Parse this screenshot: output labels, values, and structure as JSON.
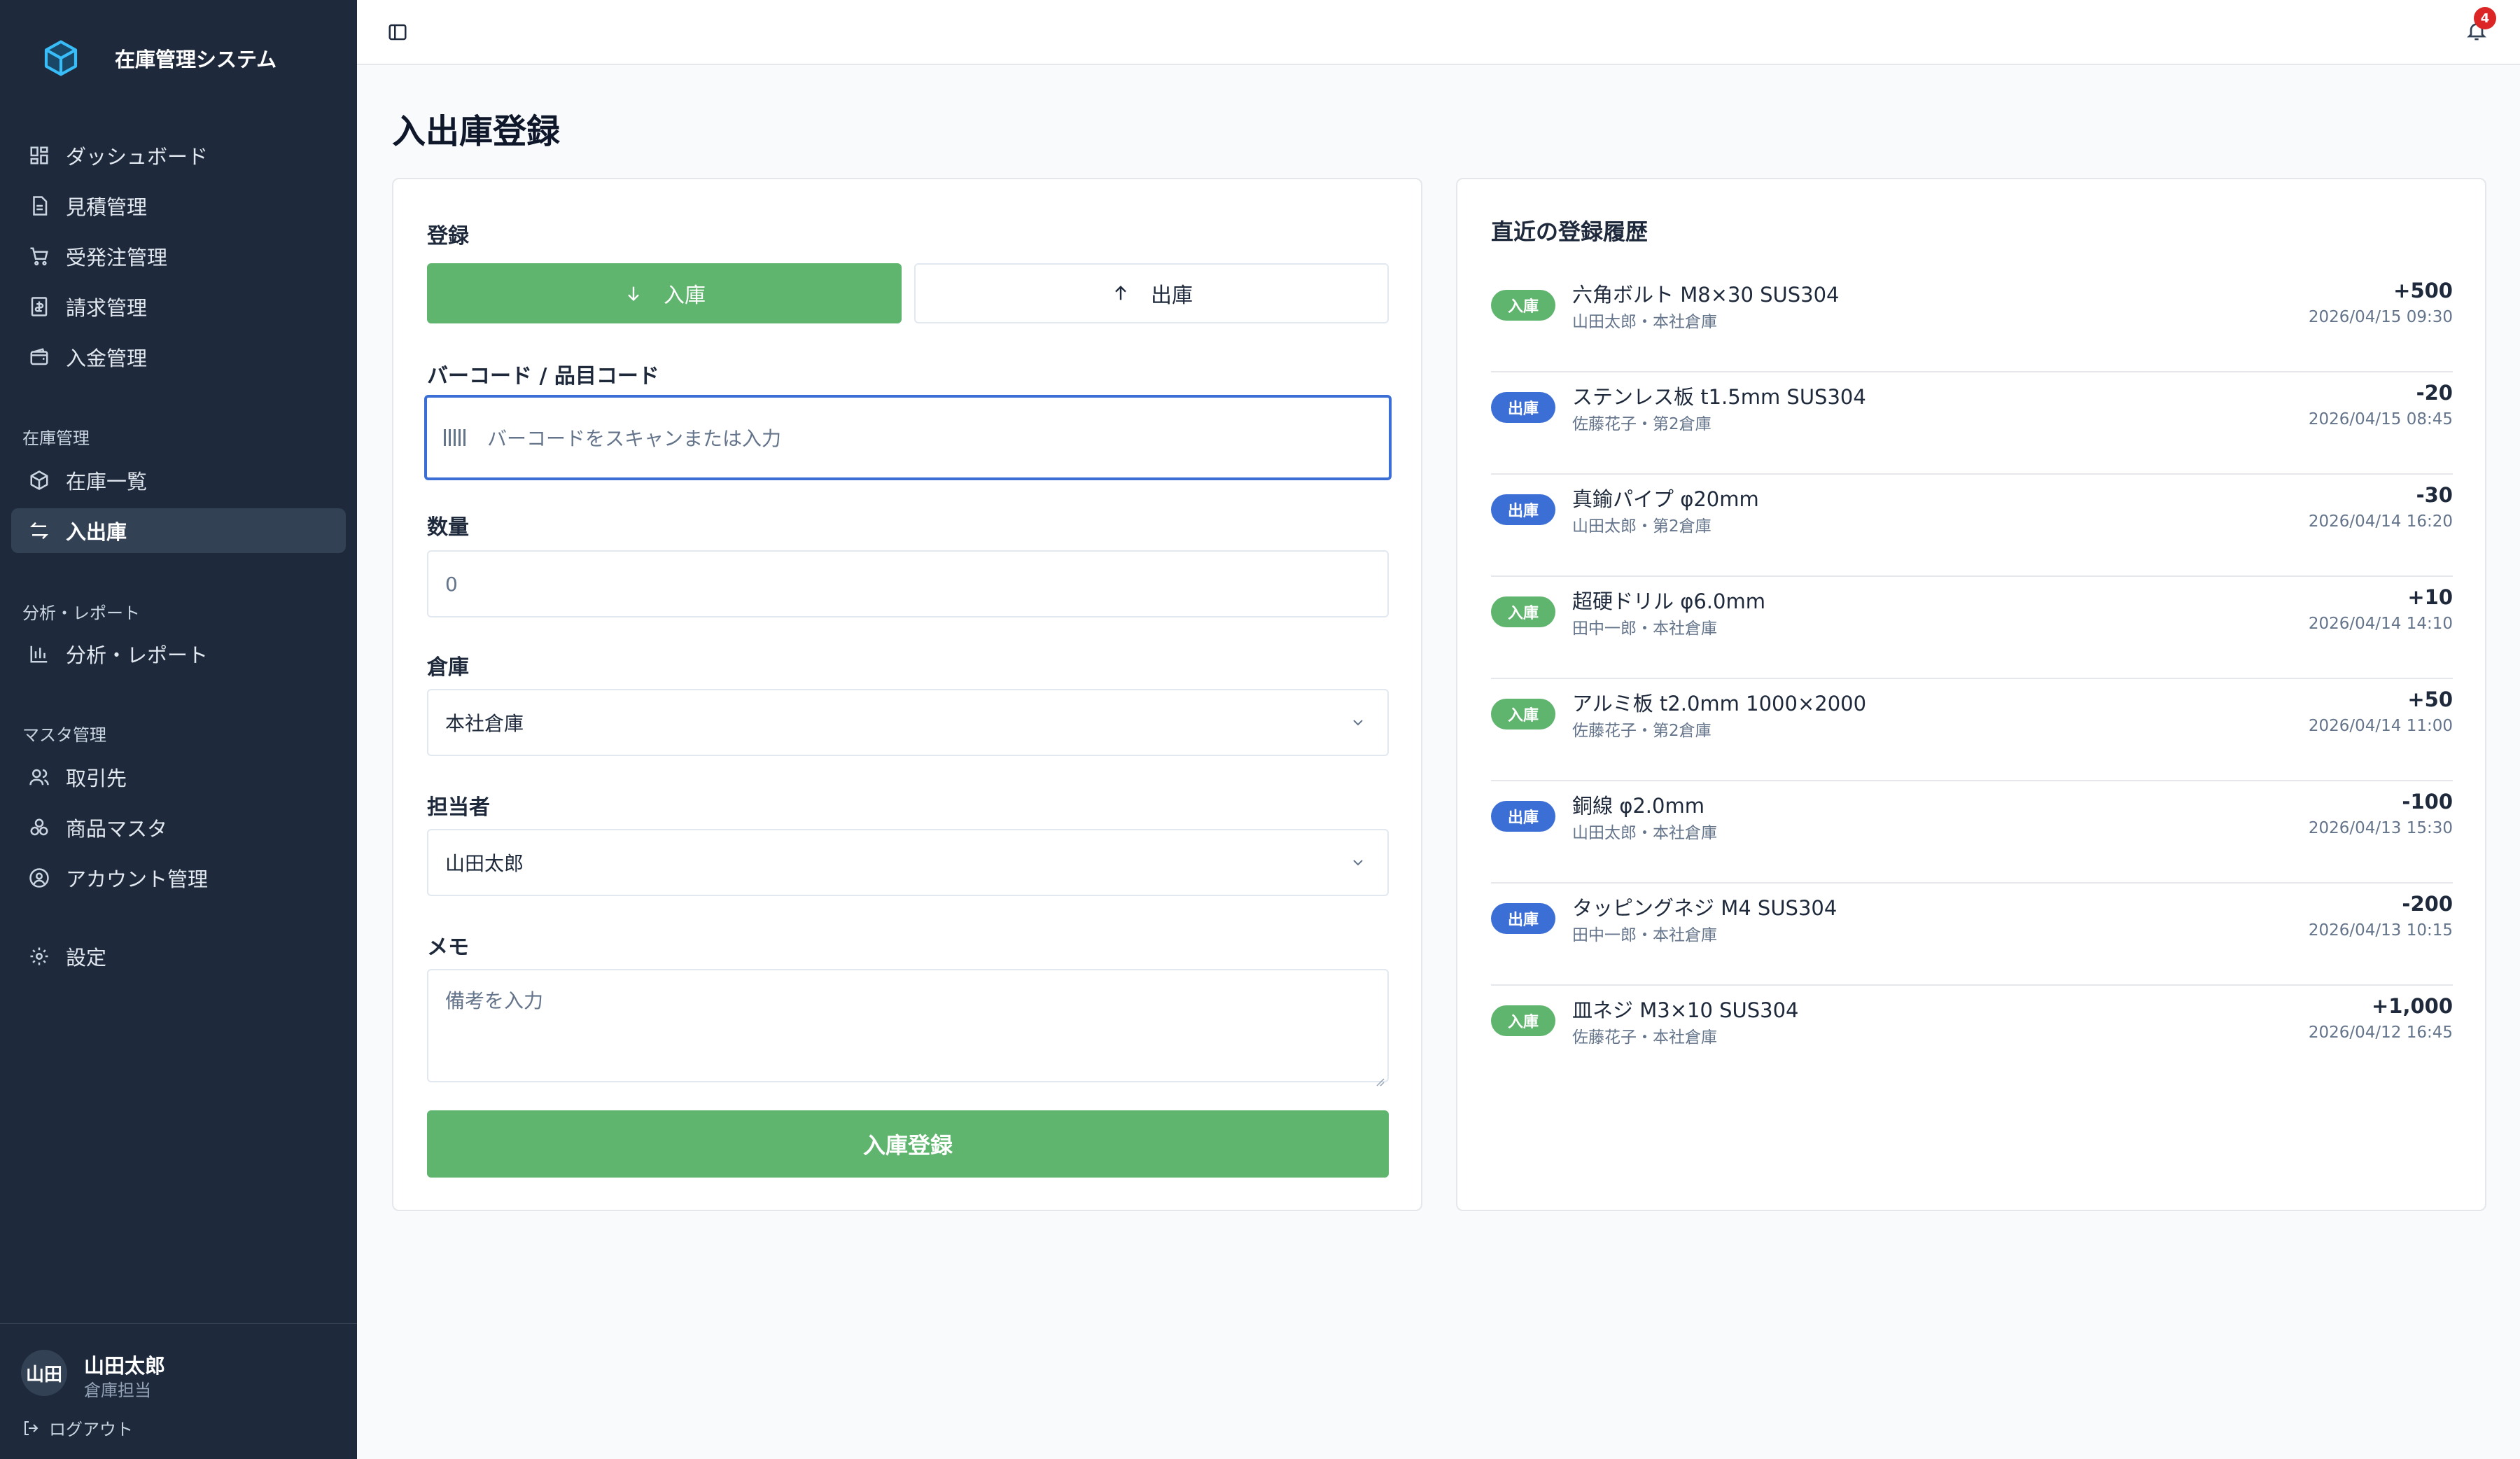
{
  "app": {
    "title": "在庫管理システム"
  },
  "sidebar": {
    "items": [
      {
        "label": "ダッシュボード",
        "icon": "dashboard-icon"
      },
      {
        "label": "見積管理",
        "icon": "document-icon"
      },
      {
        "label": "受発注管理",
        "icon": "cart-icon"
      },
      {
        "label": "請求管理",
        "icon": "invoice-icon"
      },
      {
        "label": "入金管理",
        "icon": "wallet-icon"
      }
    ],
    "section_inventory": "在庫管理",
    "inventory_items": [
      {
        "label": "在庫一覧",
        "icon": "box-icon"
      },
      {
        "label": "入出庫",
        "icon": "swap-icon",
        "active": true
      }
    ],
    "section_analysis": "分析・レポート",
    "analysis_items": [
      {
        "label": "分析・レポート",
        "icon": "bar-chart-icon"
      }
    ],
    "section_master": "マスタ管理",
    "master_items": [
      {
        "label": "取引先",
        "icon": "users-icon"
      },
      {
        "label": "商品マスタ",
        "icon": "boxes-icon"
      },
      {
        "label": "アカウント管理",
        "icon": "user-circle-icon"
      }
    ],
    "settings_item": {
      "label": "設定",
      "icon": "gear-icon"
    },
    "user": {
      "avatar": "山田",
      "name": "山田太郎",
      "role": "倉庫担当"
    },
    "logout_label": "ログアウト"
  },
  "header": {
    "notification_count": "4"
  },
  "page": {
    "title": "入出庫登録"
  },
  "form": {
    "section_label": "登録",
    "type_in_label": "入庫",
    "type_out_label": "出庫",
    "barcode_label": "バーコード / 品目コード",
    "barcode_placeholder": "バーコードをスキャンまたは入力",
    "quantity_label": "数量",
    "quantity_value": "0",
    "warehouse_label": "倉庫",
    "warehouse_value": "本社倉庫",
    "person_label": "担当者",
    "person_value": "山田太郎",
    "memo_label": "メモ",
    "memo_placeholder": "備考を入力",
    "submit_label": "入庫登録"
  },
  "history": {
    "title": "直近の登録履歴",
    "rows": [
      {
        "type": "入庫",
        "kind": "in",
        "name": "六角ボルト M8×30 SUS304",
        "sub": "山田太郎・本社倉庫",
        "qty": "+500",
        "time": "2026/04/15 09:30"
      },
      {
        "type": "出庫",
        "kind": "out",
        "name": "ステンレス板 t1.5mm SUS304",
        "sub": "佐藤花子・第2倉庫",
        "qty": "-20",
        "time": "2026/04/15 08:45"
      },
      {
        "type": "出庫",
        "kind": "out",
        "name": "真鍮パイプ φ20mm",
        "sub": "山田太郎・第2倉庫",
        "qty": "-30",
        "time": "2026/04/14 16:20"
      },
      {
        "type": "入庫",
        "kind": "in",
        "name": "超硬ドリル φ6.0mm",
        "sub": "田中一郎・本社倉庫",
        "qty": "+10",
        "time": "2026/04/14 14:10"
      },
      {
        "type": "入庫",
        "kind": "in",
        "name": "アルミ板 t2.0mm 1000×2000",
        "sub": "佐藤花子・第2倉庫",
        "qty": "+50",
        "time": "2026/04/14 11:00"
      },
      {
        "type": "出庫",
        "kind": "out",
        "name": "銅線 φ2.0mm",
        "sub": "山田太郎・本社倉庫",
        "qty": "-100",
        "time": "2026/04/13 15:30"
      },
      {
        "type": "出庫",
        "kind": "out",
        "name": "タッピングネジ M4 SUS304",
        "sub": "田中一郎・本社倉庫",
        "qty": "-200",
        "time": "2026/04/13 10:15"
      },
      {
        "type": "入庫",
        "kind": "in",
        "name": "皿ネジ M3×10 SUS304",
        "sub": "佐藤花子・本社倉庫",
        "qty": "+1,000",
        "time": "2026/04/12 16:45"
      }
    ]
  },
  "colors": {
    "sidebar_bg": "#1e293b",
    "accent_green": "#5fb56e",
    "accent_blue": "#3b6fd6",
    "badge_red": "#dc2626"
  }
}
